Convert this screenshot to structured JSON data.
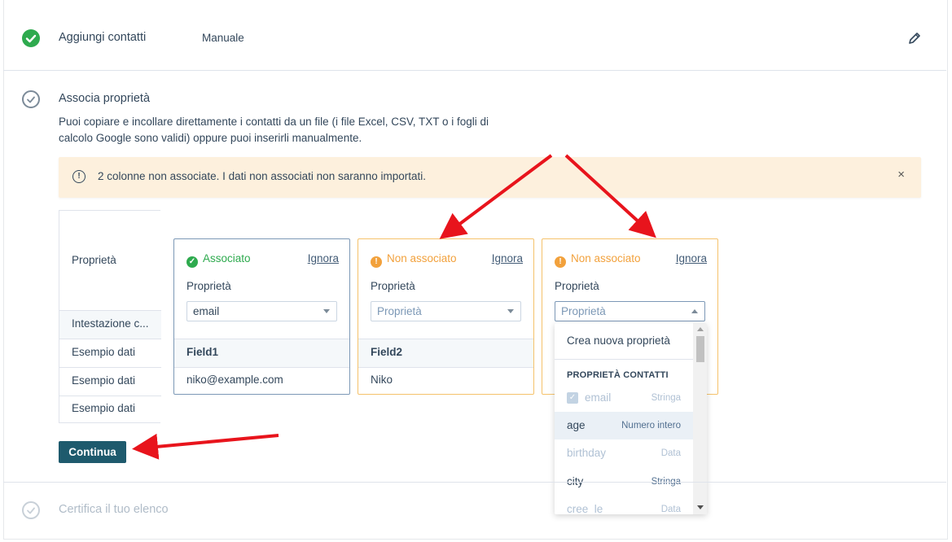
{
  "steps": {
    "step1": {
      "title": "Aggiungi contatti",
      "value": "Manuale"
    },
    "step2": {
      "title": "Associa proprietà",
      "description_line1": "Puoi copiare e incollare direttamente i contatti da un file (i file Excel, CSV, TXT o i fogli di",
      "description_line2": "calcolo Google sono validi) oppure puoi inserirli manualmente."
    },
    "step3": {
      "title": "Certifica il tuo elenco"
    }
  },
  "alert": {
    "text": "2 colonne non associate. I dati non associati non saranno importati.",
    "close": "×"
  },
  "row_labels": {
    "property": "Proprietà",
    "header": "Intestazione c...",
    "sample1": "Esempio dati",
    "sample2": "Esempio dati",
    "sample3": "Esempio dati"
  },
  "columns": [
    {
      "status": "Associato",
      "ignore": "Ignora",
      "prop_label": "Proprietà",
      "selected": "email",
      "header": "Field1",
      "sample": "niko@example.com"
    },
    {
      "status": "Non associato",
      "ignore": "Ignora",
      "prop_label": "Proprietà",
      "placeholder": "Proprietà",
      "header": "Field2",
      "sample": "Niko"
    },
    {
      "status": "Non associato",
      "ignore": "Ignora",
      "prop_label": "Proprietà",
      "placeholder": "Proprietà"
    }
  ],
  "dropdown": {
    "create": "Crea nuova proprietà",
    "group": "PROPRIETÀ CONTATTI",
    "items": [
      {
        "name": "email",
        "type": "Stringa"
      },
      {
        "name": "age",
        "type": "Numero intero"
      },
      {
        "name": "birthday",
        "type": "Data"
      },
      {
        "name": "city",
        "type": "Stringa"
      },
      {
        "name": "cree_le",
        "type": "Data"
      }
    ]
  },
  "continue_button": "Continua",
  "colors": {
    "success": "#2eaa4e",
    "warning": "#f2a13c",
    "primary": "#1e5a6d",
    "alert_bg": "#fdf0dd",
    "arrow": "#e8141c"
  }
}
